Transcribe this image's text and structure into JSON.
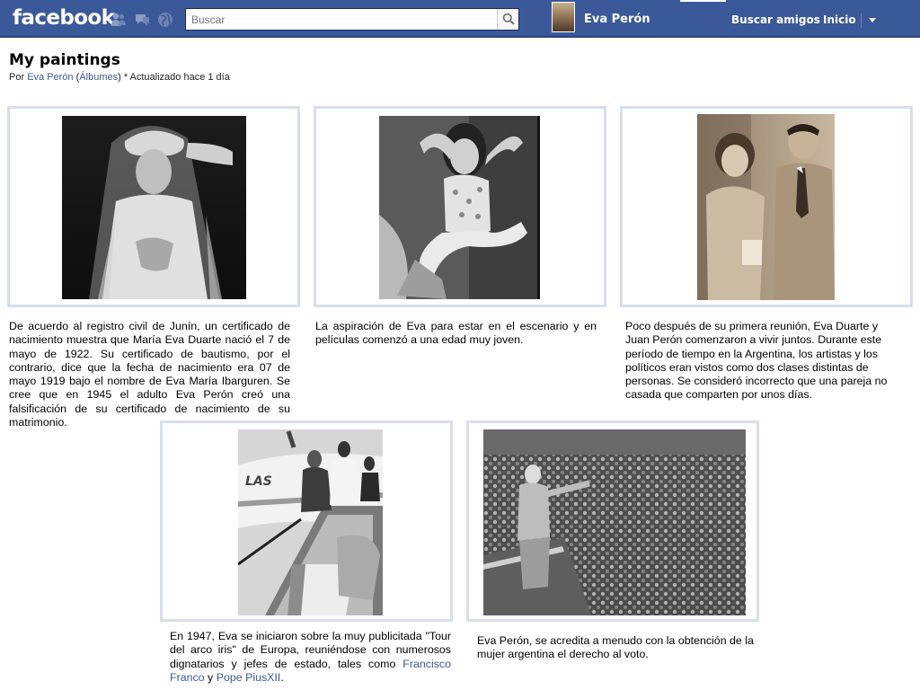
{
  "topbar": {
    "logo": "facebook",
    "jewels": [
      "friends-icon",
      "messages-icon",
      "notifications-icon"
    ],
    "search": {
      "placeholder": "Buscar",
      "value": ""
    },
    "profile_name": "Eva Perón",
    "nav": {
      "find_friends": "Buscar amigos",
      "home": "Inicio"
    },
    "brand_color": "#3b5998"
  },
  "album": {
    "title": "My paintings",
    "by": "Por",
    "author": "Eva Perón",
    "paren_open": "(",
    "albums_link": "Álbumes",
    "updated": ") * Actualizado hace 1 día"
  },
  "photos": [
    {
      "caption": "De acuerdo al registro civil de Junín, un certificado de nacimiento muestra que María Eva Duarte nació el 7 de mayo de 1922. Su certificado de bautismo, por el contrario, dice que la fecha de nacimiento era 07 de mayo 1919 bajo el nombre de Eva María Ibarguren. Se cree que en 1945 el adulto Eva Perón creó una falsificación de su certificado de nacimiento de su matrimonio."
    },
    {
      "caption": "La aspiración de Eva para estar en el escenario y en películas comenzó a una edad muy joven."
    },
    {
      "caption": "Poco después de su primera reunión, Eva Duarte y Juan Perón comenzaron a vivir juntos. Durante este período de tiempo en la Argentina, los artistas y los políticos eran vistos como dos clases distintas de personas. Se consideró incorrecto que una pareja no casada que comparten por unos días."
    },
    {
      "caption_pre": "En 1947, Eva se iniciaron sobre la muy publicitada \"Tour del arco iris\" de Europa, reuniéndose con numerosos dignatarios y jefes de estado, tales como",
      "link1": "Francisco Franco",
      "mid": "y",
      "link2": "Pope PiusXII",
      "end": "."
    },
    {
      "caption": "Eva Perón, se acredita a menudo con la obtención de la mujer argentina el derecho al voto."
    }
  ]
}
